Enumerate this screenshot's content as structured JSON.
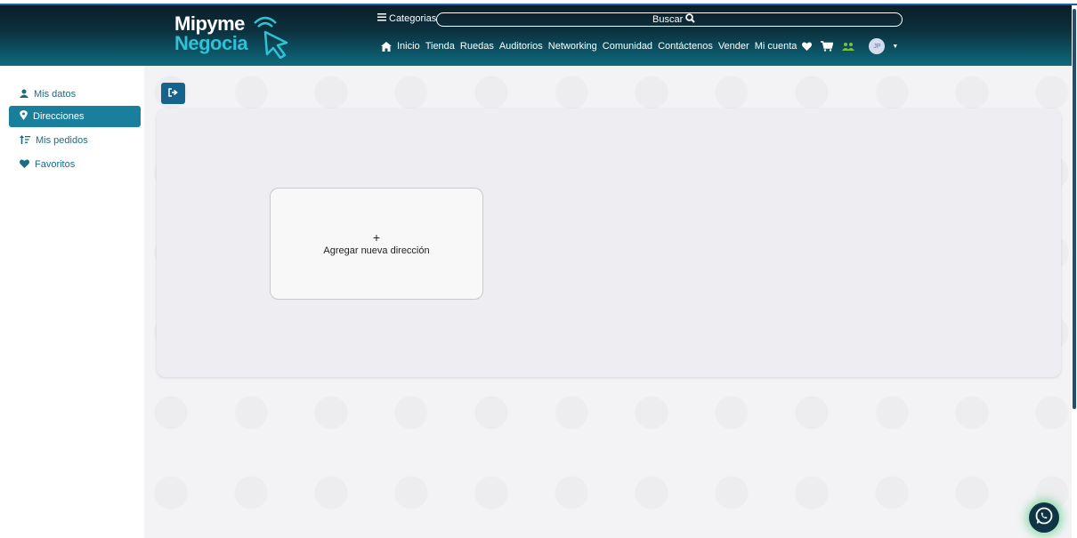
{
  "header": {
    "logo": {
      "line1": "Mipyme",
      "line2": "Negocia"
    },
    "categories_label": "Categorias",
    "search_label": "Buscar",
    "nav": [
      {
        "label": "Inicio"
      },
      {
        "label": "Tienda"
      },
      {
        "label": "Ruedas"
      },
      {
        "label": "Auditorios"
      },
      {
        "label": "Networking"
      },
      {
        "label": "Comunidad"
      },
      {
        "label": "Contáctenos"
      },
      {
        "label": "Vender"
      },
      {
        "label": "Mi cuenta"
      }
    ],
    "avatar_initials": "JP"
  },
  "sidebar": {
    "items": [
      {
        "label": "Mis datos",
        "icon": "user-icon"
      },
      {
        "label": "Direcciones",
        "icon": "location-pin-icon",
        "active": true
      },
      {
        "label": "Mis pedidos",
        "icon": "sort-orders-icon"
      },
      {
        "label": "Favoritos",
        "icon": "heart-icon"
      }
    ]
  },
  "main": {
    "add_card": {
      "plus": "+",
      "label": "Agregar nueva dirección"
    }
  },
  "colors": {
    "header_dark": "#0b1a26",
    "header_teal": "#0d6a7e",
    "accent": "#1a7f9d",
    "exit_button": "#15628a",
    "whatsapp_glow": "#48c878"
  }
}
